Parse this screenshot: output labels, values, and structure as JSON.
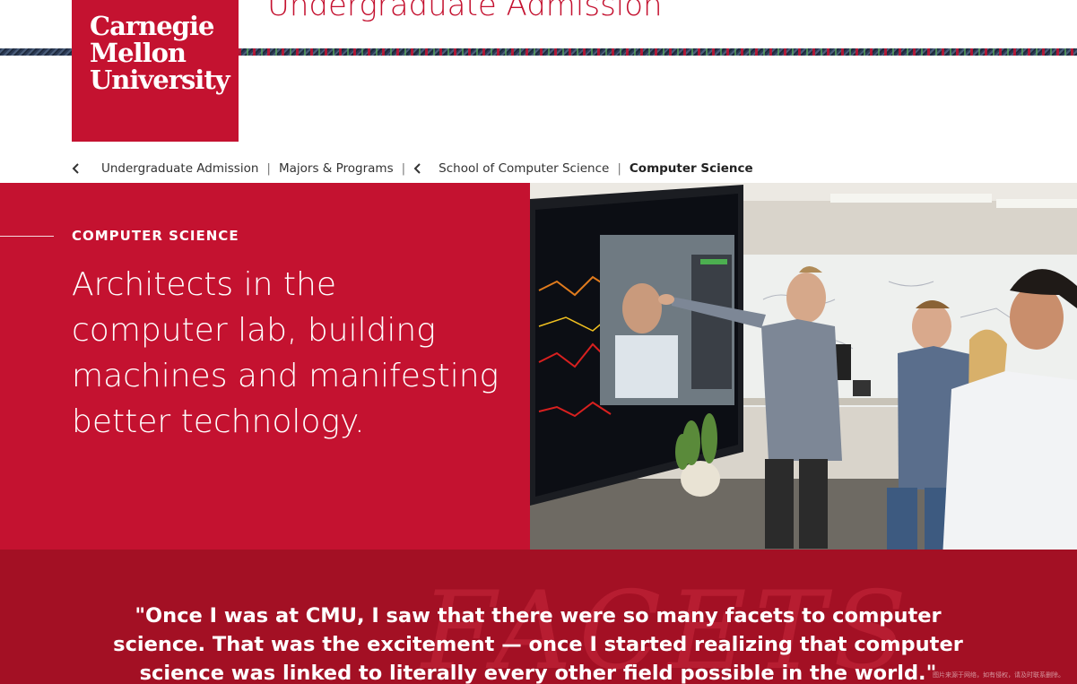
{
  "header": {
    "logo_lines": [
      "Carnegie",
      "Mellon",
      "University"
    ],
    "site_title": "Undergraduate Admission"
  },
  "breadcrumb": {
    "items": [
      {
        "label": "Undergraduate Admission"
      },
      {
        "label": "Majors & Programs"
      },
      {
        "label": "School of Computer Science"
      },
      {
        "label": "Computer Science"
      }
    ],
    "separator": "|"
  },
  "hero": {
    "eyebrow": "COMPUTER SCIENCE",
    "heading": "Architects in the computer lab, building machines and manifesting better technology."
  },
  "quote": {
    "text": "\"Once I was at CMU, I saw that there were so many facets to computer science. That was the excitement — once I started realizing that computer science was linked to literally every other field possible in the world.\"",
    "decoration": "FACETS"
  },
  "watermark": "图片来源于网络，如有侵权，请及时联系删除。",
  "colors": {
    "brand_red": "#c41230",
    "band_red": "#a31024",
    "text_dark": "#333333"
  },
  "icons": [
    "chevron-left-icon",
    "chevron-left-icon"
  ]
}
